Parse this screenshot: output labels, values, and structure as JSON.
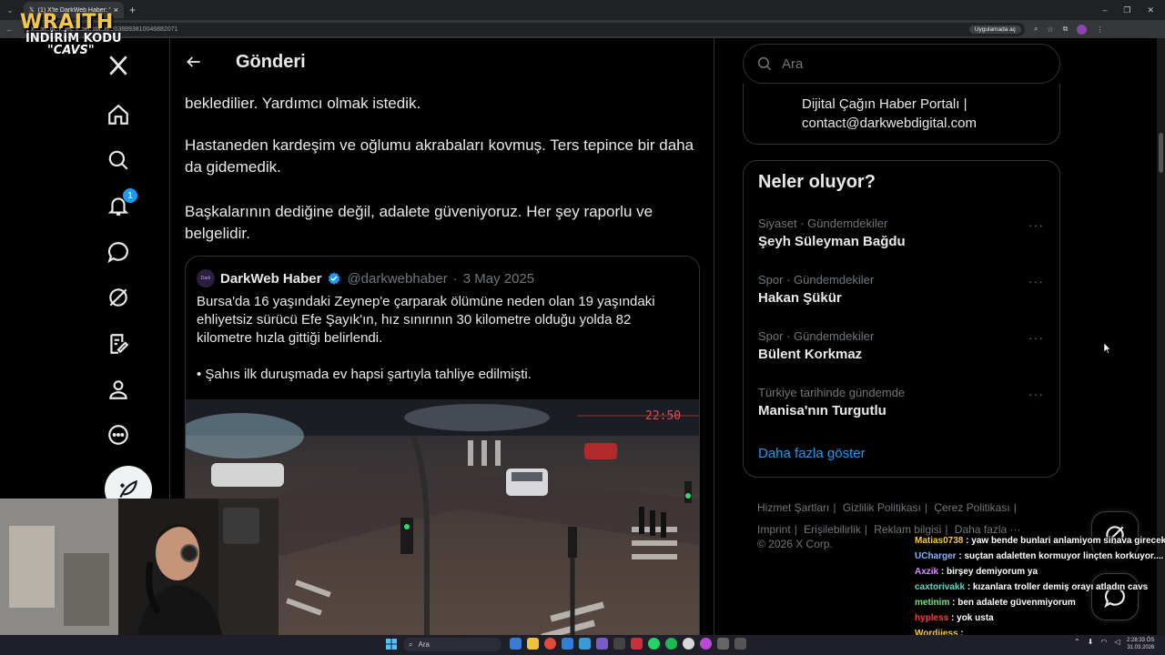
{
  "browser": {
    "tab_title": "(1) X'te DarkWeb Haber: \"Zeyn",
    "url": "x.com/darkwebhaber/status/2038893810046882071",
    "open_in_app": "Uygulamada aç"
  },
  "overlay": {
    "brand": "WRAITH",
    "discount_label": "İNDİRİM KODU",
    "code": "\"CAVS\""
  },
  "nav": {
    "notifications_count": "1",
    "icons": [
      "x-logo-icon",
      "home-icon",
      "search-icon",
      "bell-icon",
      "message-icon",
      "grok-icon",
      "compose-list-icon",
      "profile-icon",
      "more-icon",
      "post-feather-icon"
    ]
  },
  "main": {
    "title": "Gönderi",
    "paragraph_0": "bekledilier. Yardımcı olmak istedik.",
    "paragraph_1": "Hastaneden kardeşim ve oğlumu akrabaları kovmuş. Ters tepince bir daha da gidemedik.",
    "paragraph_2": "Başkalarının dediğine değil, adalete güveniyoruz. Her şey raporlu ve belgelidir.",
    "quote": {
      "author": "DarkWeb Haber",
      "handle": "@darkwebhaber",
      "separator": "·",
      "date": "3 May 2025",
      "text_1": "Bursa'da 16 yaşındaki Zeynep'e çarparak ölümüne neden olan 19 yaşındaki ehliyetsiz sürücü Efe Şayık'ın, hız sınırının 30 kilometre olduğu yolda 82 kilometre hızla gittiği belirlendi.",
      "text_2": "• Şahıs ilk duruşmada ev hapsi şartıyla tahliye edilmişti.",
      "video_timestamp": "22:50"
    }
  },
  "right": {
    "search_placeholder": "Ara",
    "who_description": "Dijital Çağın Haber Portalı | contact@darkwebdigital.com",
    "trends_title": "Neler oluyor?",
    "trends": [
      {
        "category": "Siyaset · Gündemdekiler",
        "name": "Şeyh Süleyman Bağdu"
      },
      {
        "category": "Spor · Gündemdekiler",
        "name": "Hakan Şükür"
      },
      {
        "category": "Spor · Gündemdekiler",
        "name": "Bülent Korkmaz"
      },
      {
        "category": "Türkiye tarihinde gündemde",
        "name": "Manisa'nın Turgutlu"
      }
    ],
    "trend_more": "···",
    "show_more": "Daha fazla göster",
    "footer": {
      "links": [
        "Hizmet Şartları",
        "Gizlilik Politikası",
        "Çerez Politikası",
        "Imprint",
        "Erişilebilirlik",
        "Reklam bilgisi",
        "Daha fazla ···"
      ],
      "separator": "|",
      "copyright": "© 2026 X Corp."
    }
  },
  "chat": [
    {
      "user": "Matias0738",
      "color": "#f6c744",
      "text": ": yaw bende bunlari anlamiyom sinava girecekmis yok kazanmis ehliyeti almadiysan yoktur amk"
    },
    {
      "user": "UCharger",
      "color": "#8ab4f8",
      "text": ": suçtan adaletten kormuyor linçten korkuyor...."
    },
    {
      "user": "Axzik",
      "color": "#d58cff",
      "text": ": birşey demiyorum ya"
    },
    {
      "user": "caxtorivakk",
      "color": "#5fd4c4",
      "text": ": kızanlara troller demiş orayı atladın cavs"
    },
    {
      "user": "metinim",
      "color": "#7ee07e",
      "text": ": ben adalete güvenmiyorum"
    },
    {
      "user": "hypless",
      "color": "#ff3b3b",
      "text": ": yok usta"
    },
    {
      "user": "Wordiiess",
      "color": "#f6c744",
      "text": ":"
    }
  ],
  "taskbar": {
    "search": "Ara",
    "time": "2:28:33 ÖS",
    "date": "31.03.2026"
  },
  "colors": {
    "accent": "#1d9bf0",
    "border": "#2f3336",
    "muted": "#71767b"
  }
}
